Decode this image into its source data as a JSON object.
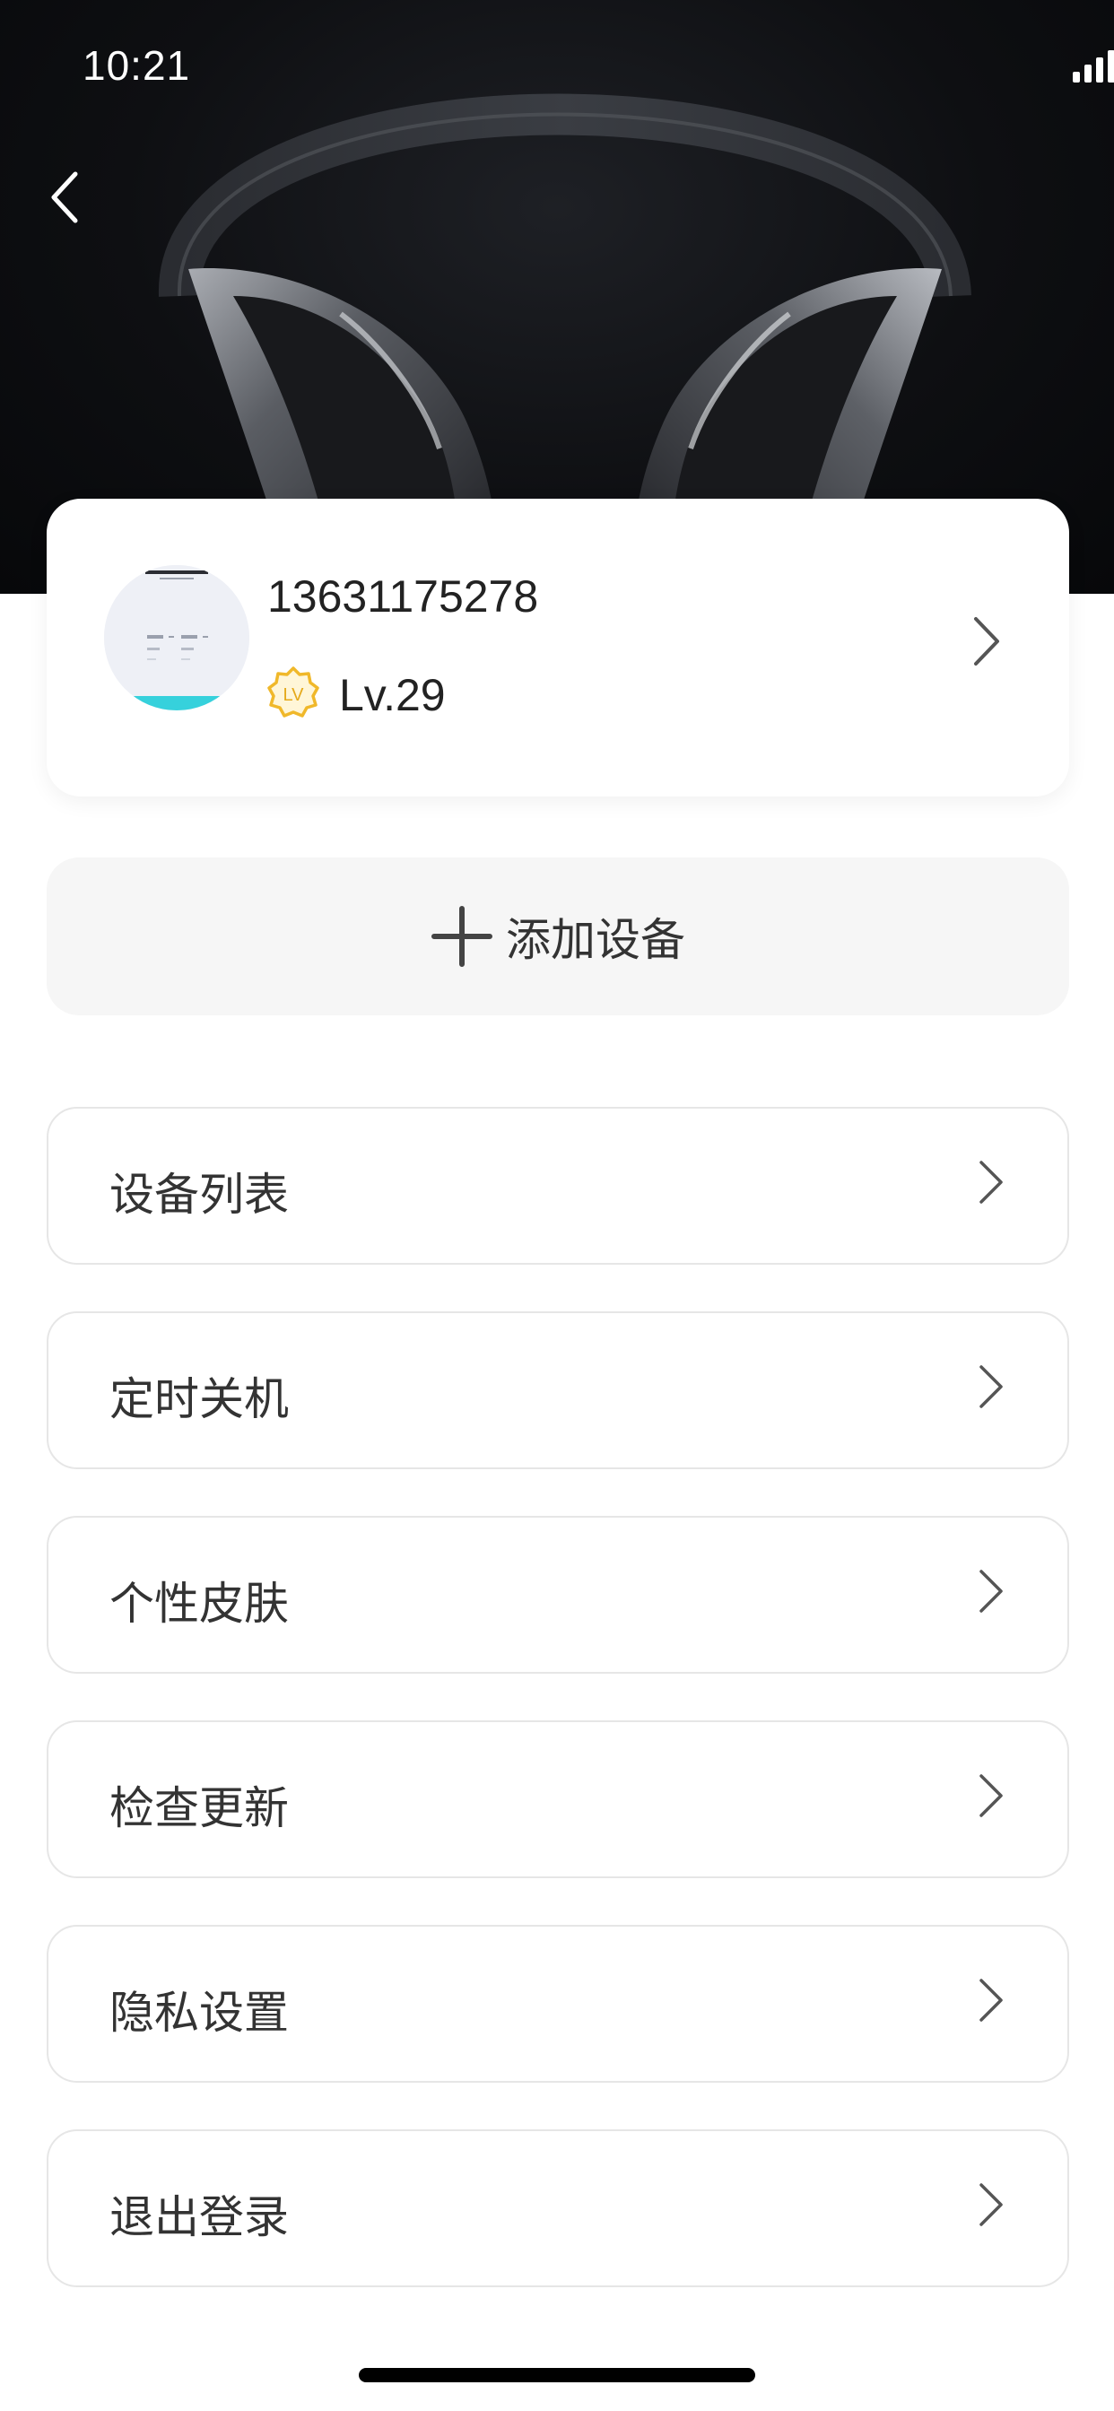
{
  "status_bar": {
    "time": "10:21"
  },
  "profile": {
    "phone": "13631175278",
    "badge": "LV",
    "level": "Lv.29"
  },
  "add_device": {
    "label": "添加设备"
  },
  "menu": [
    {
      "label": "设备列表"
    },
    {
      "label": "定时关机"
    },
    {
      "label": "个性皮肤"
    },
    {
      "label": "检查更新"
    },
    {
      "label": "隐私设置"
    },
    {
      "label": "退出登录"
    }
  ],
  "colors": {
    "accent": "#f5c518",
    "hero_bg": "#0e0f12",
    "button_bg": "#f6f6f6"
  }
}
